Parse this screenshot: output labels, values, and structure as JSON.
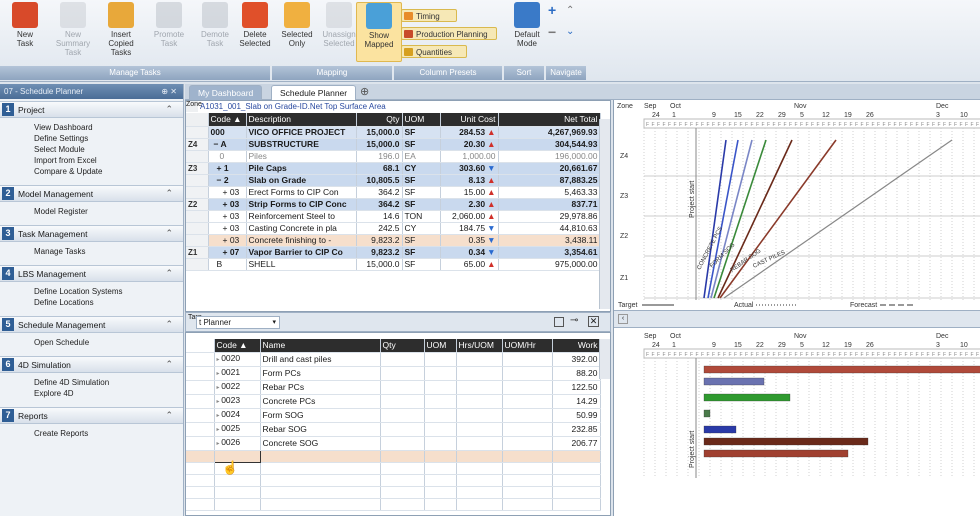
{
  "ribbon": {
    "buttons": [
      {
        "label": "New\nTask",
        "icon": "alarm-clock-icon",
        "disabled": false
      },
      {
        "label": "New Summary\nTask",
        "icon": "summary-task-icon",
        "disabled": true
      },
      {
        "label": "Insert\nCopied Tasks",
        "icon": "clipboard-icon",
        "disabled": false
      },
      {
        "label": "Promote\nTask",
        "icon": "arrow-up-icon",
        "disabled": true
      },
      {
        "label": "Demote\nTask",
        "icon": "arrow-down-icon",
        "disabled": true
      },
      {
        "label": "Delete\nSelected",
        "icon": "red-x-icon",
        "disabled": false
      },
      {
        "label": "Selected\nOnly",
        "icon": "grid-select-icon",
        "disabled": false
      },
      {
        "label": "Unassign\nSelected",
        "icon": "unassign-icon",
        "disabled": true
      },
      {
        "label": "Show\nMapped",
        "icon": "eye-icon",
        "disabled": false
      },
      {
        "label": "Default\nMode",
        "icon": "calendar-icon",
        "disabled": false
      }
    ],
    "presets": [
      "Timing",
      "Production Planning",
      "Quantities"
    ],
    "groups": [
      "Manage Tasks",
      "Mapping",
      "Column Presets",
      "Sort",
      "Navigate"
    ]
  },
  "sidebar": {
    "title": "07 - Schedule Planner",
    "controls": "⊕ ✕",
    "sections": [
      {
        "num": "1",
        "title": "Project",
        "items": [
          "View Dashboard",
          "Define Settings",
          "Select Module",
          "Import from Excel",
          "Compare & Update"
        ]
      },
      {
        "num": "2",
        "title": "Model Management",
        "items": [
          "Model Register"
        ]
      },
      {
        "num": "3",
        "title": "Task Management",
        "items": [
          "Manage Tasks"
        ]
      },
      {
        "num": "4",
        "title": "LBS Management",
        "items": [
          "Define Location Systems",
          "Define Locations"
        ]
      },
      {
        "num": "5",
        "title": "Schedule Management",
        "items": [
          "Open Schedule"
        ]
      },
      {
        "num": "6",
        "title": "4D Simulation",
        "items": [
          "Define 4D Simulation",
          "Explore 4D"
        ]
      },
      {
        "num": "7",
        "title": "Reports",
        "items": [
          "Create Reports"
        ]
      }
    ]
  },
  "tabs": [
    "My Dashboard",
    "Schedule Planner"
  ],
  "cost_grid": {
    "caption": "A1031_001_Slab on Grade-ID.Net Top Surface Area",
    "zone_label": "Zone",
    "columns": [
      "Code ▲",
      "Description",
      "Qty",
      "UOM",
      "Unit Cost",
      "Net Total"
    ],
    "rows": [
      {
        "zone": "",
        "code": "000",
        "desc": "VICO OFFICE PROJECT",
        "qty": "15,000.0",
        "uom": "SF",
        "cost": "284.53",
        "total": "4,267,969.93",
        "style": "bold",
        "arrow": "up"
      },
      {
        "zone": "Z4",
        "code": "− A",
        "desc": "SUBSTRUCTURE",
        "qty": "15,000.0",
        "uom": "SF",
        "cost": "20.30",
        "total": "304,544.93",
        "style": "bold",
        "arrow": "up"
      },
      {
        "zone": "",
        "code": "0",
        "desc": "Piles",
        "qty": "196.0",
        "uom": "EA",
        "cost": "1,000.00",
        "total": "196,000.00",
        "style": "muted",
        "arrow": ""
      },
      {
        "zone": "Z3",
        "code": "+ 1",
        "desc": "Pile Caps",
        "qty": "68.1",
        "uom": "CY",
        "cost": "303.60",
        "total": "20,661.67",
        "style": "bold",
        "arrow": "down"
      },
      {
        "zone": "",
        "code": "− 2",
        "desc": "Slab on Grade",
        "qty": "10,805.5",
        "uom": "SF",
        "cost": "8.13",
        "total": "87,883.25",
        "style": "bold",
        "arrow": "up"
      },
      {
        "zone": "",
        "code": "+ 03",
        "desc": "Erect Forms to CIP Con",
        "qty": "364.2",
        "uom": "SF",
        "cost": "15.00",
        "total": "5,463.33",
        "style": "normal",
        "arrow": "up"
      },
      {
        "zone": "Z2",
        "code": "+ 03",
        "desc": "Strip Forms to CIP Conc",
        "qty": "364.2",
        "uom": "SF",
        "cost": "2.30",
        "total": "837.71",
        "style": "bold",
        "arrow": "up"
      },
      {
        "zone": "",
        "code": "+ 03",
        "desc": "Reinforcement Steel to",
        "qty": "14.6",
        "uom": "TON",
        "cost": "2,060.00",
        "total": "29,978.86",
        "style": "normal",
        "arrow": "up"
      },
      {
        "zone": "",
        "code": "+ 03",
        "desc": "Casting Concrete in pla",
        "qty": "242.5",
        "uom": "CY",
        "cost": "184.75",
        "total": "44,810.63",
        "style": "normal",
        "arrow": "down"
      },
      {
        "zone": "",
        "code": "+ 03",
        "desc": "Concrete finishing to -",
        "qty": "9,823.2",
        "uom": "SF",
        "cost": "0.35",
        "total": "3,438.11",
        "style": "highlight",
        "arrow": "down"
      },
      {
        "zone": "Z1",
        "code": "+ 07",
        "desc": "Vapor Barrier to CIP Co",
        "qty": "9,823.2",
        "uom": "SF",
        "cost": "0.34",
        "total": "3,354.61",
        "style": "bold",
        "arrow": "down"
      },
      {
        "zone": "",
        "code": "B",
        "desc": "SHELL",
        "qty": "15,000.0",
        "uom": "SF",
        "cost": "65.00",
        "total": "975,000.00",
        "style": "normal",
        "arrow": "up"
      }
    ]
  },
  "planner": {
    "target_label": "Targ",
    "dropdown": "t Planner"
  },
  "task_grid": {
    "columns": [
      "Code ▲",
      "Name",
      "Qty",
      "UOM",
      "Hrs/UOM",
      "UOM/Hr",
      "Work"
    ],
    "rows": [
      {
        "code": "0020",
        "name": "Drill and cast piles",
        "work": "392.00"
      },
      {
        "code": "0021",
        "name": "Form PCs",
        "work": "88.20"
      },
      {
        "code": "0022",
        "name": "Rebar PCs",
        "work": "122.50"
      },
      {
        "code": "0023",
        "name": "Concrete PCs",
        "work": "14.29"
      },
      {
        "code": "0024",
        "name": "Form SOG",
        "work": "50.99"
      },
      {
        "code": "0025",
        "name": "Rebar SOG",
        "work": "232.85"
      },
      {
        "code": "0026",
        "name": "Concrete SOG",
        "work": "206.77"
      }
    ]
  },
  "flowline": {
    "zone_label": "Zone",
    "months": [
      "Sep",
      "Oct",
      "Nov",
      "Dec"
    ],
    "days": [
      "24",
      "1",
      "9",
      "15",
      "22",
      "29",
      "5",
      "12",
      "19",
      "26",
      "3",
      "10"
    ],
    "zones": [
      "Z4",
      "Z3",
      "Z2",
      "Z1"
    ],
    "project_start": "Project start",
    "line_labels": [
      "CONCRETE PCS",
      "FORM SOG",
      "CAST PILES",
      "REBAR SOG"
    ],
    "legend": {
      "target": "Target",
      "actual": "Actual",
      "forecast": "Forecast"
    },
    "line_colors": [
      "#2a3aa8",
      "#3a55c8",
      "#7a86c6",
      "#3a8a3a",
      "#6a2a1a",
      "#8a3a2a",
      "#888888"
    ]
  },
  "gantt": {
    "months": [
      "Sep",
      "Oct",
      "Nov",
      "Dec"
    ],
    "days": [
      "24",
      "1",
      "9",
      "15",
      "22",
      "29",
      "5",
      "12",
      "19",
      "26",
      "3",
      "10"
    ],
    "project_start": "Project start",
    "bar_colors": [
      "#b04a3a",
      "#6a72b0",
      "#2f9a2f",
      "#4a7a4a",
      "#2a3aa8",
      "#6a2a1a",
      "#a04030"
    ]
  }
}
